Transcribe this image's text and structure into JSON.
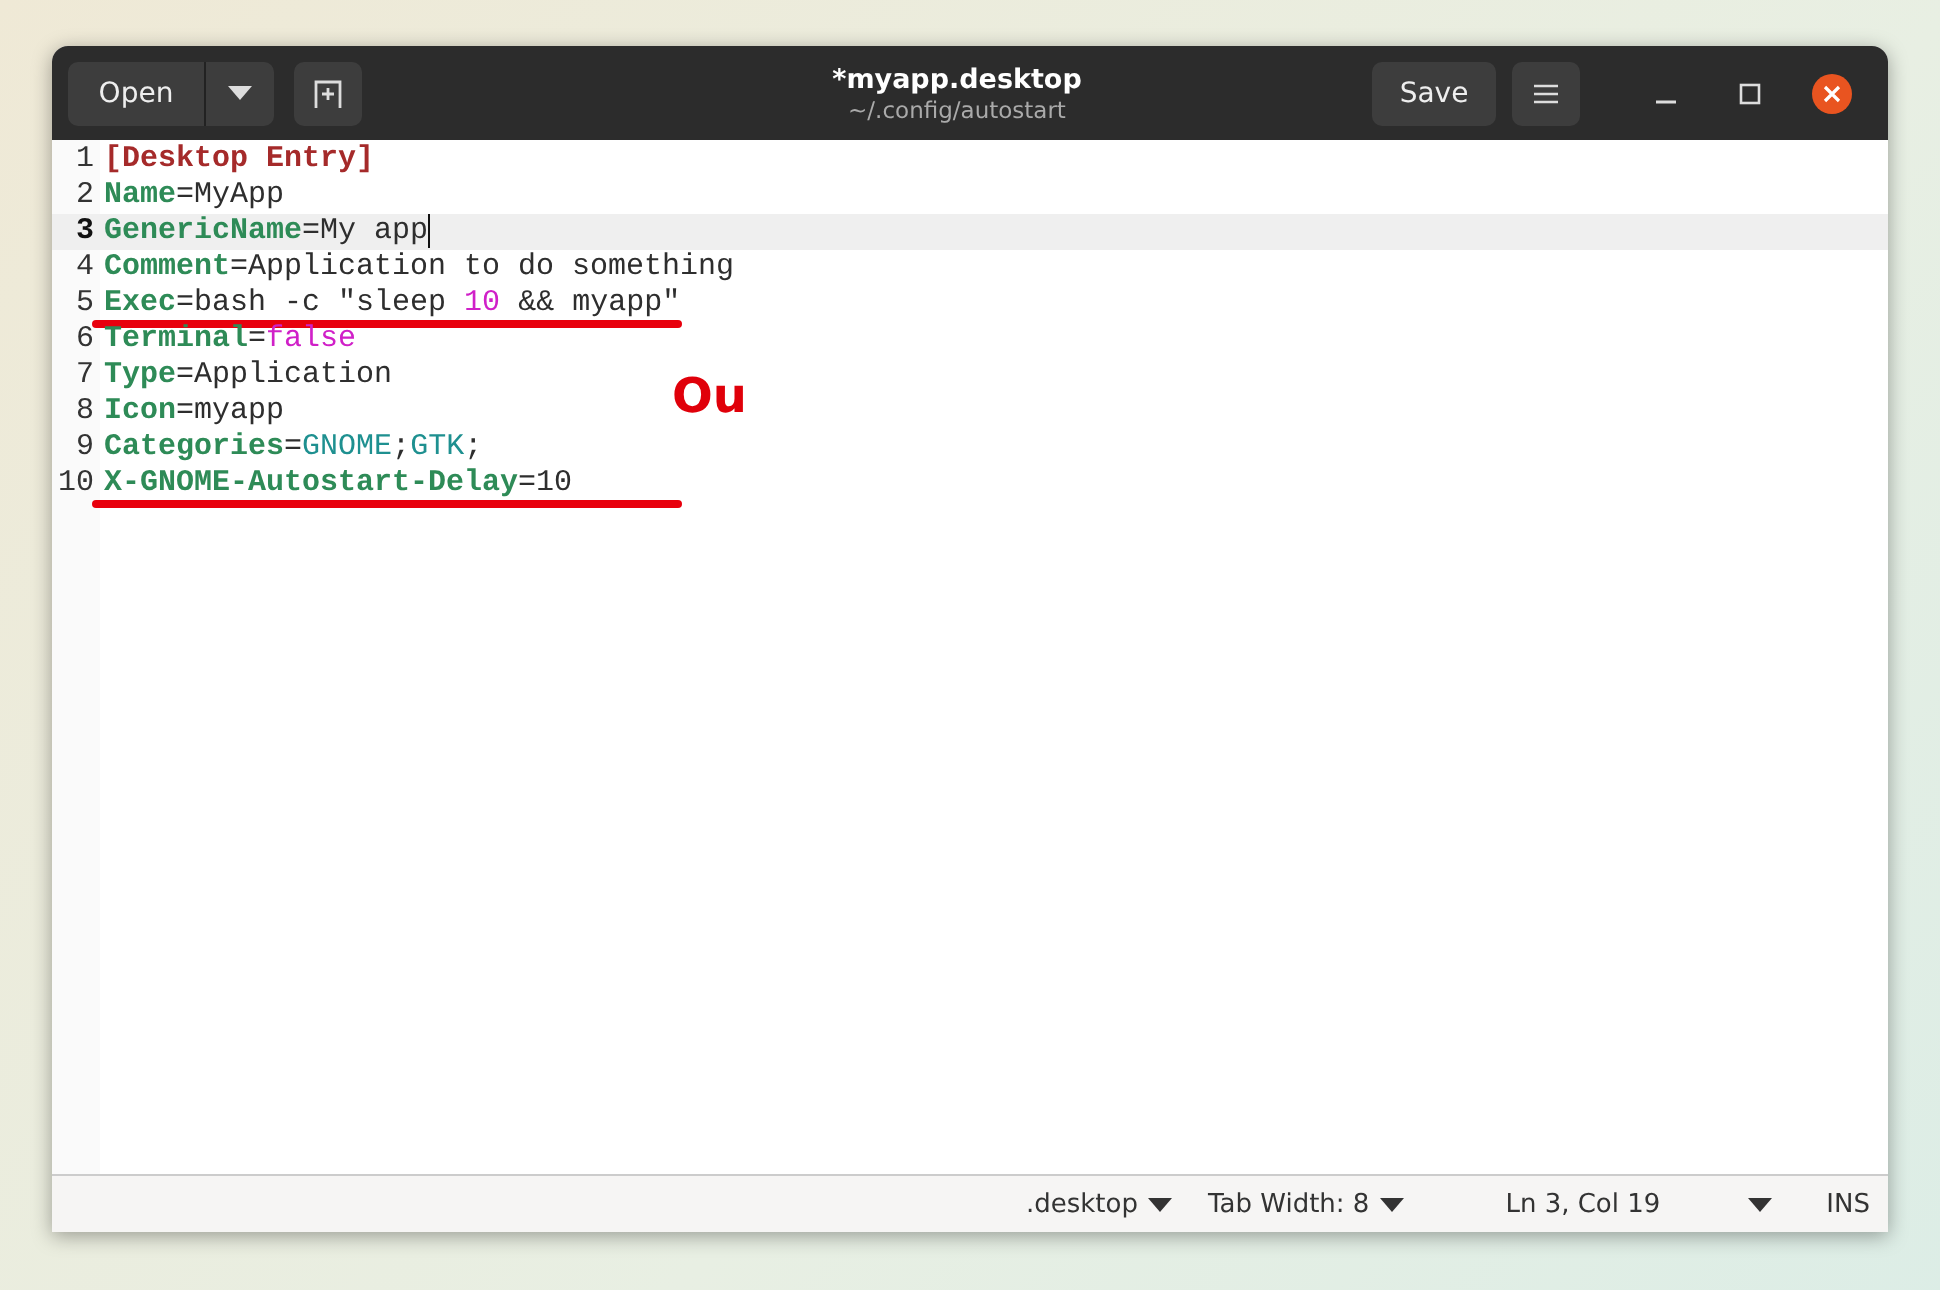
{
  "header": {
    "open_button": "Open",
    "title": "*myapp.desktop",
    "subtitle": "~/.config/autostart",
    "save_button": "Save"
  },
  "editor": {
    "lines": [
      {
        "number": "1",
        "current": false,
        "underlined": false,
        "segments": [
          {
            "kind": "section",
            "text": "[Desktop Entry]"
          }
        ]
      },
      {
        "number": "2",
        "current": false,
        "underlined": false,
        "segments": [
          {
            "kind": "key",
            "text": "Name"
          },
          {
            "kind": "plain",
            "text": "=MyApp"
          }
        ]
      },
      {
        "number": "3",
        "current": true,
        "underlined": false,
        "segments": [
          {
            "kind": "key",
            "text": "GenericName"
          },
          {
            "kind": "plain",
            "text": "=My app"
          }
        ]
      },
      {
        "number": "4",
        "current": false,
        "underlined": false,
        "segments": [
          {
            "kind": "key",
            "text": "Comment"
          },
          {
            "kind": "plain",
            "text": "=Application to do something"
          }
        ]
      },
      {
        "number": "5",
        "current": false,
        "underlined": true,
        "segments": [
          {
            "kind": "key",
            "text": "Exec"
          },
          {
            "kind": "plain",
            "text": "=bash -c \"sleep "
          },
          {
            "kind": "number",
            "text": "10"
          },
          {
            "kind": "plain",
            "text": " && myapp\""
          }
        ]
      },
      {
        "number": "6",
        "current": false,
        "underlined": false,
        "segments": [
          {
            "kind": "key",
            "text": "Terminal"
          },
          {
            "kind": "plain",
            "text": "="
          },
          {
            "kind": "number",
            "text": "false"
          }
        ]
      },
      {
        "number": "7",
        "current": false,
        "underlined": false,
        "segments": [
          {
            "kind": "key",
            "text": "Type"
          },
          {
            "kind": "plain",
            "text": "=Application"
          }
        ]
      },
      {
        "number": "8",
        "current": false,
        "underlined": false,
        "segments": [
          {
            "kind": "key",
            "text": "Icon"
          },
          {
            "kind": "plain",
            "text": "=myapp"
          }
        ]
      },
      {
        "number": "9",
        "current": false,
        "underlined": false,
        "segments": [
          {
            "kind": "key",
            "text": "Categories"
          },
          {
            "kind": "plain",
            "text": "="
          },
          {
            "kind": "value",
            "text": "GNOME"
          },
          {
            "kind": "plain",
            "text": ";"
          },
          {
            "kind": "value",
            "text": "GTK"
          },
          {
            "kind": "plain",
            "text": ";"
          }
        ]
      },
      {
        "number": "10",
        "current": false,
        "underlined": true,
        "segments": [
          {
            "kind": "key",
            "text": "X-GNOME-Autostart-Delay"
          },
          {
            "kind": "plain",
            "text": "=10"
          }
        ]
      }
    ],
    "annotation": "Ou"
  },
  "status_bar": {
    "language": ".desktop",
    "tab_width": "Tab Width: 8",
    "position": "Ln 3, Col 19",
    "mode": "INS"
  }
}
